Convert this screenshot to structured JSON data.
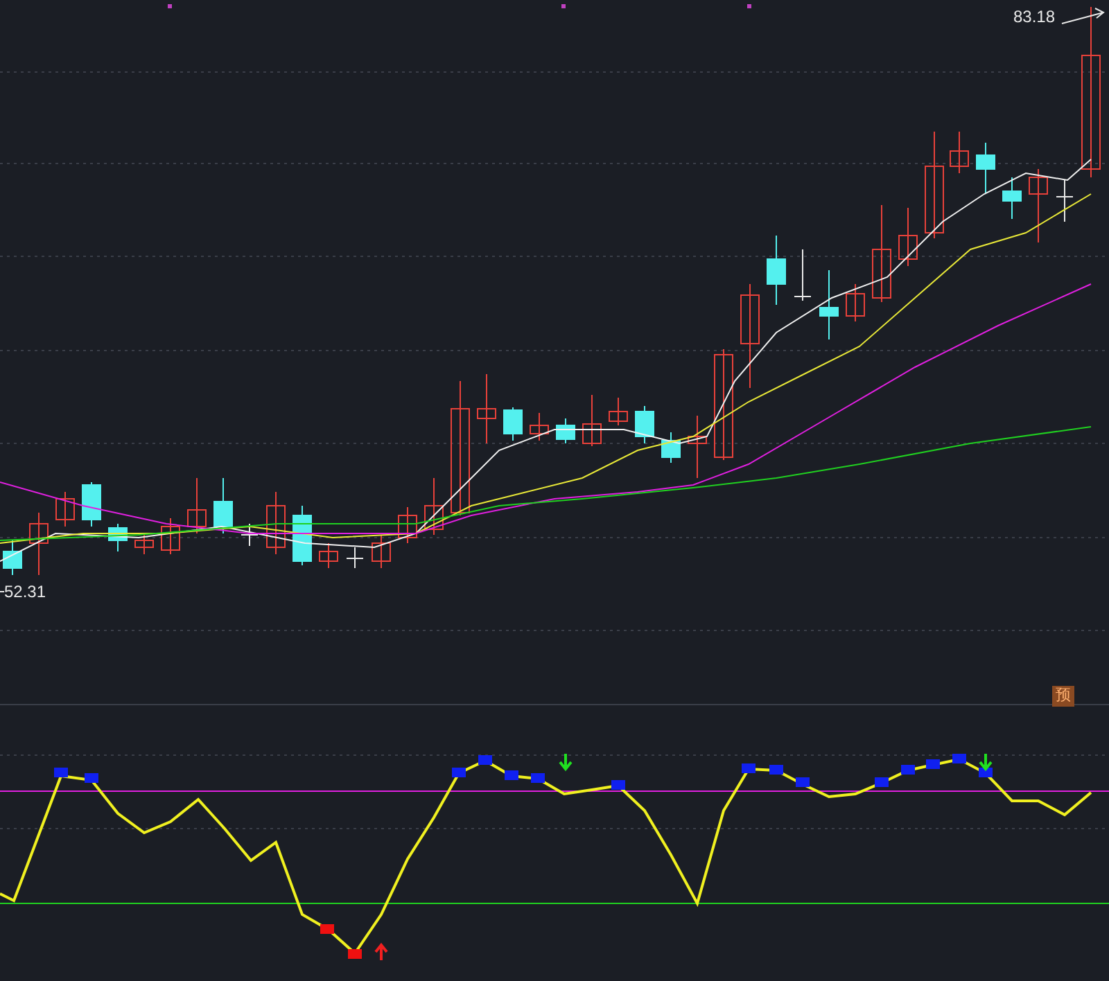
{
  "main_chart": {
    "high_label": "83.18",
    "low_label": "52.31",
    "forecast_badge": "预"
  }
}
